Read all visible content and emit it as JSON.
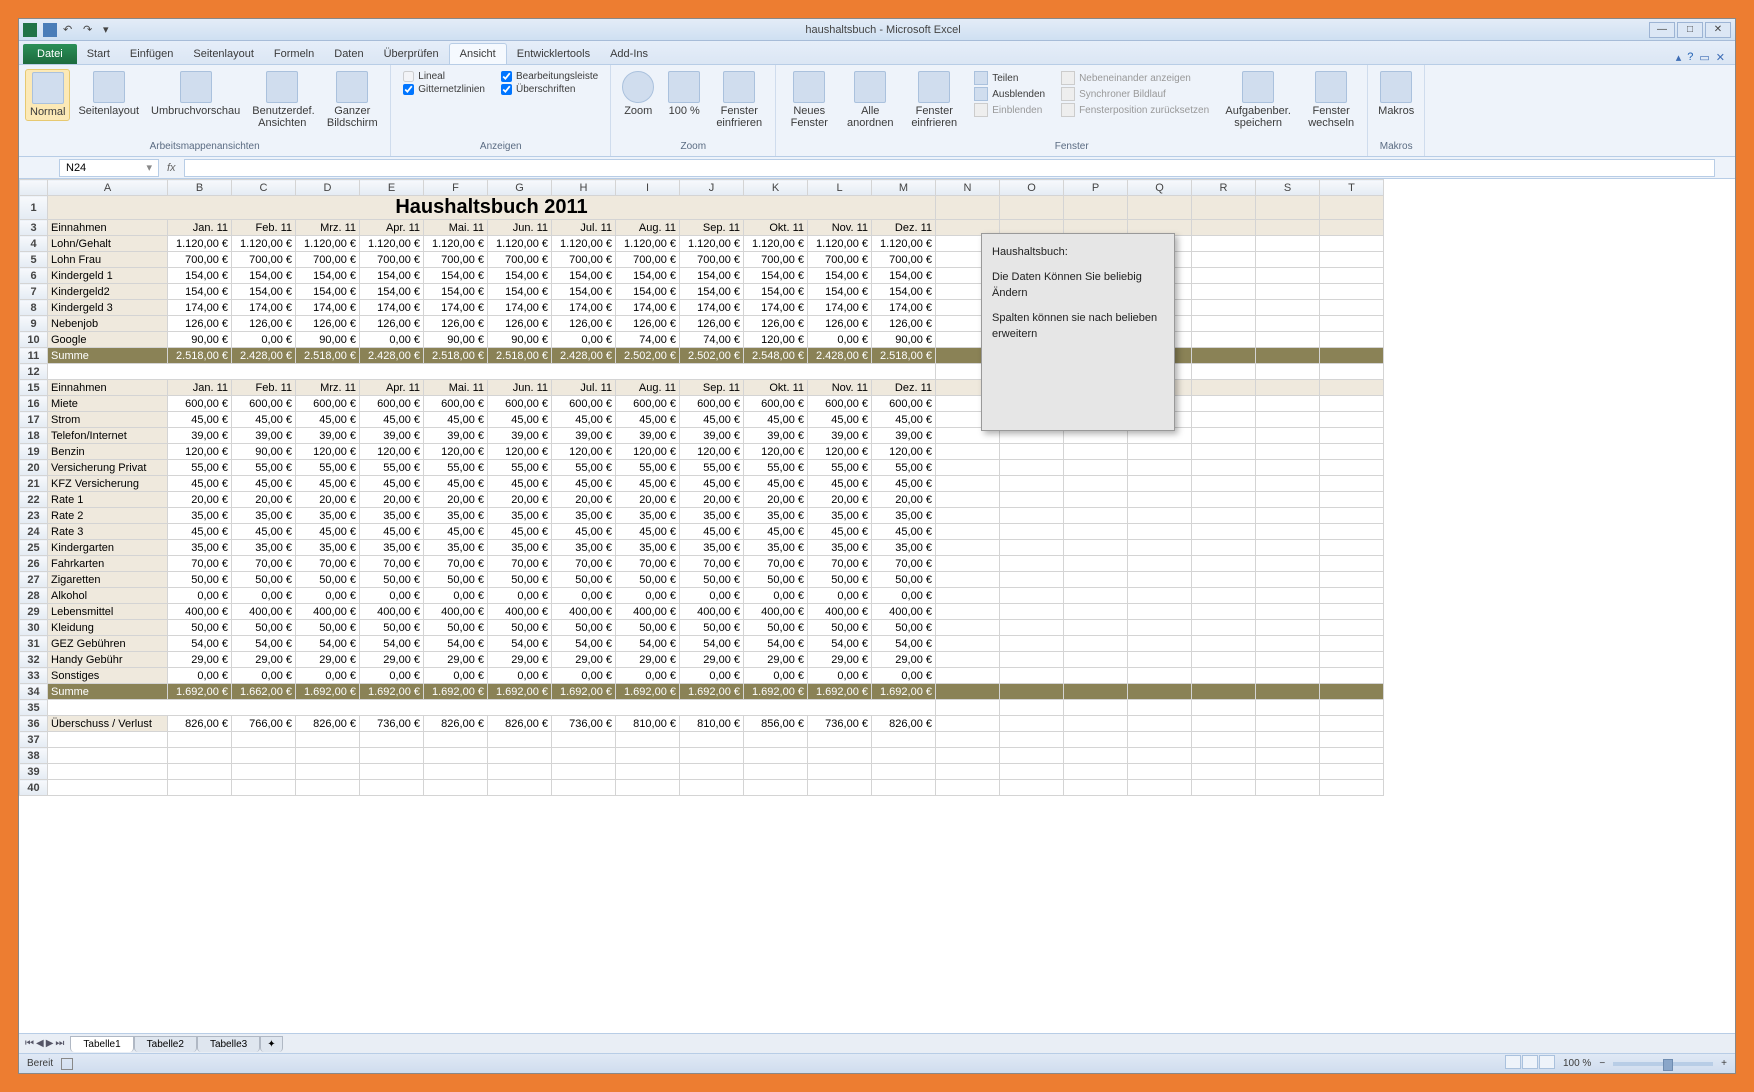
{
  "app": {
    "title": "haushaltsbuch - Microsoft Excel"
  },
  "qat": {
    "save": "💾",
    "undo": "↶",
    "redo": "↷"
  },
  "tabs": {
    "file": "Datei",
    "start": "Start",
    "einfuegen": "Einfügen",
    "seitenlayout": "Seitenlayout",
    "formeln": "Formeln",
    "daten": "Daten",
    "ueberpruefen": "Überprüfen",
    "ansicht": "Ansicht",
    "entwickler": "Entwicklertools",
    "addins": "Add-Ins"
  },
  "ribbon": {
    "group1": {
      "label": "Arbeitsmappenansichten",
      "normal": "Normal",
      "seitenlayout": "Seitenlayout",
      "umbruch": "Umbruchvorschau",
      "benutzer": "Benutzerdef. Ansichten",
      "ganzer": "Ganzer Bildschirm"
    },
    "group2": {
      "label": "Anzeigen",
      "lineal": "Lineal",
      "bearbeitungsleiste": "Bearbeitungsleiste",
      "gitter": "Gitternetzlinien",
      "ueberschriften": "Überschriften"
    },
    "group3": {
      "label": "Zoom",
      "zoom": "Zoom",
      "z100": "100 %",
      "fenster_einfrieren": "Fenster einfrieren"
    },
    "group4": {
      "label": "Fenster",
      "neues": "Neues Fenster",
      "alle": "Alle anordnen",
      "einfrieren": "Fenster einfrieren",
      "teilen": "Teilen",
      "ausblenden": "Ausblenden",
      "einblenden": "Einblenden",
      "nebeneinander": "Nebeneinander anzeigen",
      "synchron": "Synchroner Bildlauf",
      "position": "Fensterposition zurücksetzen",
      "aufgaben": "Aufgabenber. speichern",
      "wechseln": "Fenster wechseln"
    },
    "group5": {
      "label": "Makros",
      "makros": "Makros"
    }
  },
  "namebox": "N24",
  "columns": [
    "",
    "A",
    "B",
    "C",
    "D",
    "E",
    "F",
    "G",
    "H",
    "I",
    "J",
    "K",
    "L",
    "M",
    "N",
    "O",
    "P",
    "Q",
    "R",
    "S",
    "T"
  ],
  "title_cell": "Haushaltsbuch 2011",
  "months": [
    "Jan. 11",
    "Feb. 11",
    "Mrz. 11",
    "Apr. 11",
    "Mai. 11",
    "Jun. 11",
    "Jul. 11",
    "Aug. 11",
    "Sep. 11",
    "Okt. 11",
    "Nov. 11",
    "Dez. 11"
  ],
  "section1": {
    "header": "Einnahmen",
    "rows": [
      {
        "label": "Lohn/Gehalt",
        "v": [
          "1.120,00 €",
          "1.120,00 €",
          "1.120,00 €",
          "1.120,00 €",
          "1.120,00 €",
          "1.120,00 €",
          "1.120,00 €",
          "1.120,00 €",
          "1.120,00 €",
          "1.120,00 €",
          "1.120,00 €",
          "1.120,00 €"
        ]
      },
      {
        "label": "Lohn Frau",
        "v": [
          "700,00 €",
          "700,00 €",
          "700,00 €",
          "700,00 €",
          "700,00 €",
          "700,00 €",
          "700,00 €",
          "700,00 €",
          "700,00 €",
          "700,00 €",
          "700,00 €",
          "700,00 €"
        ]
      },
      {
        "label": "Kindergeld 1",
        "v": [
          "154,00 €",
          "154,00 €",
          "154,00 €",
          "154,00 €",
          "154,00 €",
          "154,00 €",
          "154,00 €",
          "154,00 €",
          "154,00 €",
          "154,00 €",
          "154,00 €",
          "154,00 €"
        ]
      },
      {
        "label": "Kindergeld2",
        "v": [
          "154,00 €",
          "154,00 €",
          "154,00 €",
          "154,00 €",
          "154,00 €",
          "154,00 €",
          "154,00 €",
          "154,00 €",
          "154,00 €",
          "154,00 €",
          "154,00 €",
          "154,00 €"
        ]
      },
      {
        "label": "Kindergeld 3",
        "v": [
          "174,00 €",
          "174,00 €",
          "174,00 €",
          "174,00 €",
          "174,00 €",
          "174,00 €",
          "174,00 €",
          "174,00 €",
          "174,00 €",
          "174,00 €",
          "174,00 €",
          "174,00 €"
        ]
      },
      {
        "label": "Nebenjob",
        "v": [
          "126,00 €",
          "126,00 €",
          "126,00 €",
          "126,00 €",
          "126,00 €",
          "126,00 €",
          "126,00 €",
          "126,00 €",
          "126,00 €",
          "126,00 €",
          "126,00 €",
          "126,00 €"
        ]
      },
      {
        "label": "Google",
        "v": [
          "90,00 €",
          "0,00 €",
          "90,00 €",
          "0,00 €",
          "90,00 €",
          "90,00 €",
          "0,00 €",
          "74,00 €",
          "74,00 €",
          "120,00 €",
          "0,00 €",
          "90,00 €"
        ]
      }
    ],
    "sum": {
      "label": "Summe",
      "v": [
        "2.518,00 €",
        "2.428,00 €",
        "2.518,00 €",
        "2.428,00 €",
        "2.518,00 €",
        "2.518,00 €",
        "2.428,00 €",
        "2.502,00 €",
        "2.502,00 €",
        "2.548,00 €",
        "2.428,00 €",
        "2.518,00 €"
      ]
    }
  },
  "section2": {
    "header": "Einnahmen",
    "rows": [
      {
        "label": "Miete",
        "v": [
          "600,00 €",
          "600,00 €",
          "600,00 €",
          "600,00 €",
          "600,00 €",
          "600,00 €",
          "600,00 €",
          "600,00 €",
          "600,00 €",
          "600,00 €",
          "600,00 €",
          "600,00 €"
        ]
      },
      {
        "label": "Strom",
        "v": [
          "45,00 €",
          "45,00 €",
          "45,00 €",
          "45,00 €",
          "45,00 €",
          "45,00 €",
          "45,00 €",
          "45,00 €",
          "45,00 €",
          "45,00 €",
          "45,00 €",
          "45,00 €"
        ]
      },
      {
        "label": "Telefon/Internet",
        "v": [
          "39,00 €",
          "39,00 €",
          "39,00 €",
          "39,00 €",
          "39,00 €",
          "39,00 €",
          "39,00 €",
          "39,00 €",
          "39,00 €",
          "39,00 €",
          "39,00 €",
          "39,00 €"
        ]
      },
      {
        "label": "Benzin",
        "v": [
          "120,00 €",
          "90,00 €",
          "120,00 €",
          "120,00 €",
          "120,00 €",
          "120,00 €",
          "120,00 €",
          "120,00 €",
          "120,00 €",
          "120,00 €",
          "120,00 €",
          "120,00 €"
        ]
      },
      {
        "label": "Versicherung Privat",
        "v": [
          "55,00 €",
          "55,00 €",
          "55,00 €",
          "55,00 €",
          "55,00 €",
          "55,00 €",
          "55,00 €",
          "55,00 €",
          "55,00 €",
          "55,00 €",
          "55,00 €",
          "55,00 €"
        ]
      },
      {
        "label": "KFZ Versicherung",
        "v": [
          "45,00 €",
          "45,00 €",
          "45,00 €",
          "45,00 €",
          "45,00 €",
          "45,00 €",
          "45,00 €",
          "45,00 €",
          "45,00 €",
          "45,00 €",
          "45,00 €",
          "45,00 €"
        ]
      },
      {
        "label": "Rate 1",
        "v": [
          "20,00 €",
          "20,00 €",
          "20,00 €",
          "20,00 €",
          "20,00 €",
          "20,00 €",
          "20,00 €",
          "20,00 €",
          "20,00 €",
          "20,00 €",
          "20,00 €",
          "20,00 €"
        ]
      },
      {
        "label": "Rate 2",
        "v": [
          "35,00 €",
          "35,00 €",
          "35,00 €",
          "35,00 €",
          "35,00 €",
          "35,00 €",
          "35,00 €",
          "35,00 €",
          "35,00 €",
          "35,00 €",
          "35,00 €",
          "35,00 €"
        ]
      },
      {
        "label": "Rate 3",
        "v": [
          "45,00 €",
          "45,00 €",
          "45,00 €",
          "45,00 €",
          "45,00 €",
          "45,00 €",
          "45,00 €",
          "45,00 €",
          "45,00 €",
          "45,00 €",
          "45,00 €",
          "45,00 €"
        ]
      },
      {
        "label": "Kindergarten",
        "v": [
          "35,00 €",
          "35,00 €",
          "35,00 €",
          "35,00 €",
          "35,00 €",
          "35,00 €",
          "35,00 €",
          "35,00 €",
          "35,00 €",
          "35,00 €",
          "35,00 €",
          "35,00 €"
        ]
      },
      {
        "label": "Fahrkarten",
        "v": [
          "70,00 €",
          "70,00 €",
          "70,00 €",
          "70,00 €",
          "70,00 €",
          "70,00 €",
          "70,00 €",
          "70,00 €",
          "70,00 €",
          "70,00 €",
          "70,00 €",
          "70,00 €"
        ]
      },
      {
        "label": "Zigaretten",
        "v": [
          "50,00 €",
          "50,00 €",
          "50,00 €",
          "50,00 €",
          "50,00 €",
          "50,00 €",
          "50,00 €",
          "50,00 €",
          "50,00 €",
          "50,00 €",
          "50,00 €",
          "50,00 €"
        ]
      },
      {
        "label": "Alkohol",
        "v": [
          "0,00 €",
          "0,00 €",
          "0,00 €",
          "0,00 €",
          "0,00 €",
          "0,00 €",
          "0,00 €",
          "0,00 €",
          "0,00 €",
          "0,00 €",
          "0,00 €",
          "0,00 €"
        ]
      },
      {
        "label": "Lebensmittel",
        "v": [
          "400,00 €",
          "400,00 €",
          "400,00 €",
          "400,00 €",
          "400,00 €",
          "400,00 €",
          "400,00 €",
          "400,00 €",
          "400,00 €",
          "400,00 €",
          "400,00 €",
          "400,00 €"
        ]
      },
      {
        "label": "Kleidung",
        "v": [
          "50,00 €",
          "50,00 €",
          "50,00 €",
          "50,00 €",
          "50,00 €",
          "50,00 €",
          "50,00 €",
          "50,00 €",
          "50,00 €",
          "50,00 €",
          "50,00 €",
          "50,00 €"
        ]
      },
      {
        "label": "GEZ Gebühren",
        "v": [
          "54,00 €",
          "54,00 €",
          "54,00 €",
          "54,00 €",
          "54,00 €",
          "54,00 €",
          "54,00 €",
          "54,00 €",
          "54,00 €",
          "54,00 €",
          "54,00 €",
          "54,00 €"
        ]
      },
      {
        "label": "Handy Gebühr",
        "v": [
          "29,00 €",
          "29,00 €",
          "29,00 €",
          "29,00 €",
          "29,00 €",
          "29,00 €",
          "29,00 €",
          "29,00 €",
          "29,00 €",
          "29,00 €",
          "29,00 €",
          "29,00 €"
        ]
      },
      {
        "label": "Sonstiges",
        "v": [
          "0,00 €",
          "0,00 €",
          "0,00 €",
          "0,00 €",
          "0,00 €",
          "0,00 €",
          "0,00 €",
          "0,00 €",
          "0,00 €",
          "0,00 €",
          "0,00 €",
          "0,00 €"
        ]
      }
    ],
    "sum": {
      "label": "Summe",
      "v": [
        "1.692,00 €",
        "1.662,00 €",
        "1.692,00 €",
        "1.692,00 €",
        "1.692,00 €",
        "1.692,00 €",
        "1.692,00 €",
        "1.692,00 €",
        "1.692,00 €",
        "1.692,00 €",
        "1.692,00 €",
        "1.692,00 €"
      ]
    }
  },
  "ueberschuss": {
    "label": "Überschuss / Verlust",
    "v": [
      "826,00 €",
      "766,00 €",
      "826,00 €",
      "736,00 €",
      "826,00 €",
      "826,00 €",
      "736,00 €",
      "810,00 €",
      "810,00 €",
      "856,00 €",
      "736,00 €",
      "826,00 €"
    ]
  },
  "note": {
    "title": "Haushaltsbuch:",
    "line1": "Die Daten Können Sie beliebig Ändern",
    "line2": "Spalten können sie nach belieben erweitern"
  },
  "sheets": {
    "t1": "Tabelle1",
    "t2": "Tabelle2",
    "t3": "Tabelle3"
  },
  "status": {
    "ready": "Bereit",
    "zoom": "100 %"
  }
}
